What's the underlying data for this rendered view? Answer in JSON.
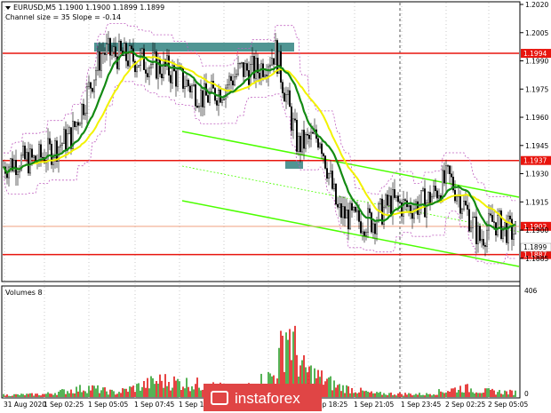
{
  "header": {
    "symbol_line": "EURUSD,M5  1.1900 1.1900 1.1899 1.1899",
    "indicator_line": "Channel size = 35 Slope = -0.14"
  },
  "volume_panel": {
    "label": "Volumes 8",
    "y_ticks": [
      "406",
      "0"
    ]
  },
  "watermark": {
    "text": "instaforex"
  },
  "colors": {
    "bull": "#2ca02c",
    "bear": "#e11414",
    "resistance": "#e8150e",
    "channel": "#4cff00",
    "ma_fast": "#f2f200",
    "ma_slow": "#138a13",
    "zone": "#3d8a87",
    "bands": "#c060c0"
  },
  "chart_data": {
    "type": "candlestick",
    "y_ticks": [
      "1.2020",
      "1.2005",
      "1.1990",
      "1.1975",
      "1.1960",
      "1.1945",
      "1.1930",
      "1.1915",
      "1.1900",
      "1.1885"
    ],
    "ylim": [
      1.1875,
      1.202
    ],
    "x_ticks": [
      "31 Aug 2020",
      "1 Sep 02:25",
      "1 Sep 05:05",
      "1 Sep 07:45",
      "1 Sep 10:25",
      "1 Sep 13:05",
      "1 Sep 15:45",
      "1 Sep 18:25",
      "1 Sep 21:05",
      "1 Sep 23:45",
      "2 Sep 02:25",
      "2 Sep 05:05"
    ],
    "levels": [
      {
        "label": "1.1994",
        "value": 1.1994
      },
      {
        "label": "1.1937",
        "value": 1.1937
      },
      {
        "label": "1.1902",
        "value": 1.1902
      },
      {
        "label": "1.1887",
        "value": 1.1887
      }
    ],
    "current_price": "1.1899",
    "price_path": [
      {
        "t": 0,
        "p": 1.1933
      },
      {
        "t": 20,
        "p": 1.1937
      },
      {
        "t": 40,
        "p": 1.1937
      },
      {
        "t": 60,
        "p": 1.1943
      },
      {
        "t": 80,
        "p": 1.195
      },
      {
        "t": 100,
        "p": 1.1975
      },
      {
        "t": 115,
        "p": 1.1995
      },
      {
        "t": 140,
        "p": 1.1992
      },
      {
        "t": 160,
        "p": 1.199
      },
      {
        "t": 190,
        "p": 1.1985
      },
      {
        "t": 210,
        "p": 1.1978
      },
      {
        "t": 230,
        "p": 1.197
      },
      {
        "t": 250,
        "p": 1.1975
      },
      {
        "t": 270,
        "p": 1.1985
      },
      {
        "t": 290,
        "p": 1.1985
      },
      {
        "t": 310,
        "p": 1.1995
      },
      {
        "t": 320,
        "p": 1.1975
      },
      {
        "t": 335,
        "p": 1.1945
      },
      {
        "t": 360,
        "p": 1.195
      },
      {
        "t": 380,
        "p": 1.191
      },
      {
        "t": 400,
        "p": 1.1905
      },
      {
        "t": 420,
        "p": 1.1905
      },
      {
        "t": 440,
        "p": 1.1915
      },
      {
        "t": 460,
        "p": 1.1912
      },
      {
        "t": 480,
        "p": 1.1915
      },
      {
        "t": 505,
        "p": 1.1928
      },
      {
        "t": 520,
        "p": 1.1915
      },
      {
        "t": 540,
        "p": 1.1895
      },
      {
        "t": 555,
        "p": 1.1905
      },
      {
        "t": 575,
        "p": 1.1899
      }
    ],
    "volume_path": [
      {
        "t": 0,
        "v": 8
      },
      {
        "t": 50,
        "v": 12
      },
      {
        "t": 100,
        "v": 40
      },
      {
        "t": 130,
        "v": 18
      },
      {
        "t": 180,
        "v": 70
      },
      {
        "t": 220,
        "v": 55
      },
      {
        "t": 270,
        "v": 30
      },
      {
        "t": 310,
        "v": 95
      },
      {
        "t": 323,
        "v": 300
      },
      {
        "t": 340,
        "v": 120
      },
      {
        "t": 380,
        "v": 45
      },
      {
        "t": 420,
        "v": 15
      },
      {
        "t": 480,
        "v": 12
      },
      {
        "t": 520,
        "v": 40
      },
      {
        "t": 545,
        "v": 25
      },
      {
        "t": 575,
        "v": 20
      }
    ],
    "volume_ylim": [
      0,
      406
    ]
  }
}
